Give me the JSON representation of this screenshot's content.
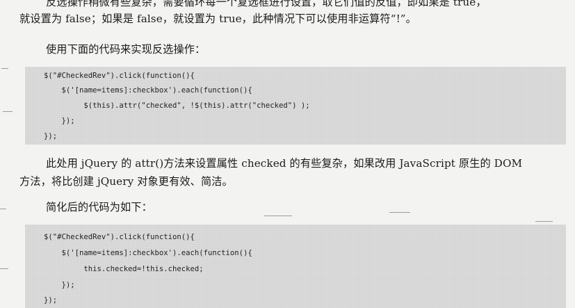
{
  "paragraphs": {
    "p1_line1": "反选操作稍微有些复杂，需要循环每一个复选框进行设置，取它们值的反值，即如果是 true，",
    "p1_line2": "就设置为 false；如果是 false，就设置为 true，此种情况下可以使用非运算符“!”。",
    "p2": "使用下面的代码来实现反选操作：",
    "p3_line1": "此处用 jQuery 的 attr()方法来设置属性 checked 的有些复杂，如果改用 JavaScript 原生的 DOM",
    "p3_line2": "方法，将比创建 jQuery 对象更有效、简洁。",
    "p4": "简化后的代码为如下："
  },
  "code_block_1": [
    "$(\"#CheckedRev\").click(function(){",
    "    $('[name=items]:checkbox').each(function(){",
    "         $(this).attr(\"checked\", !$(this).attr(\"checked\") );",
    "    });",
    "});"
  ],
  "code_block_2": [
    "$(\"#CheckedRev\").click(function(){",
    "    $('[name=items]:checkbox').each(function(){",
    "         this.checked=!this.checked;",
    "    });",
    "});"
  ]
}
